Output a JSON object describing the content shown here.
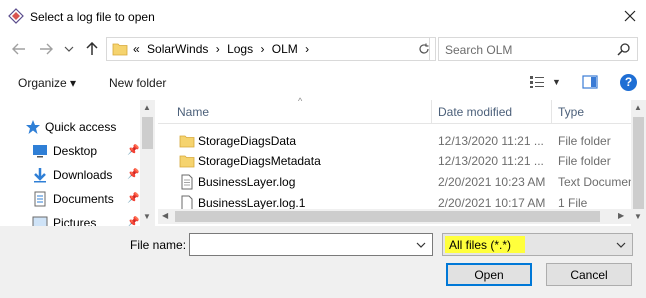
{
  "window": {
    "title": "Select a log file to open"
  },
  "nav": {
    "breadcrumb_prefix": "«",
    "crumbs": [
      "SolarWinds",
      "Logs",
      "OLM"
    ],
    "search_placeholder": "Search OLM"
  },
  "toolbar": {
    "organize_label": "Organize ▾",
    "new_folder_label": "New folder",
    "help_label": "?"
  },
  "sidebar": {
    "items": [
      {
        "label": "Quick access",
        "icon": "star-icon"
      },
      {
        "label": "Desktop",
        "icon": "desktop-icon"
      },
      {
        "label": "Downloads",
        "icon": "downloads-icon"
      },
      {
        "label": "Documents",
        "icon": "documents-icon"
      },
      {
        "label": "Pictures",
        "icon": "pictures-icon"
      }
    ]
  },
  "columns": {
    "name": "Name",
    "date": "Date modified",
    "type": "Type"
  },
  "files": [
    {
      "name": "StorageDiagsData",
      "date": "12/13/2020 11:21 ...",
      "type": "File folder",
      "icon": "folder-icon"
    },
    {
      "name": "StorageDiagsMetadata",
      "date": "12/13/2020 11:21 ...",
      "type": "File folder",
      "icon": "folder-icon"
    },
    {
      "name": "BusinessLayer.log",
      "date": "2/20/2021 10:23 AM",
      "type": "Text Documen",
      "icon": "text-file-icon"
    },
    {
      "name": "BusinessLayer.log.1",
      "date": "2/20/2021 10:17 AM",
      "type": "1 File",
      "icon": "file-icon"
    }
  ],
  "footer": {
    "file_name_label": "File name:",
    "file_name_value": "",
    "filter_value": "All files (*.*)",
    "open_label": "Open",
    "cancel_label": "Cancel"
  },
  "colors": {
    "accent": "#0078d7",
    "highlight": "#ffff3c",
    "folder": "#e8b84a"
  }
}
